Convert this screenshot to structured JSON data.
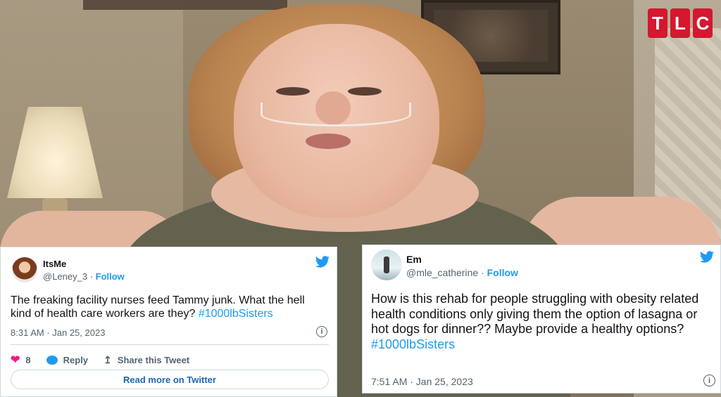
{
  "brand": {
    "logo_letters": [
      "T",
      "L",
      "C"
    ],
    "color": "#d3182f"
  },
  "tweet1": {
    "name": "ItsMe",
    "handle": "@Leney_3",
    "separator": " · ",
    "follow_label": "Follow",
    "text": "The freaking facility nurses feed Tammy junk. What the hell kind of health care workers are they? ",
    "hashtag": "#1000lbSisters",
    "timestamp": "8:31 AM · Jan 25, 2023",
    "likes": "8",
    "reply_label": "Reply",
    "share_label": "Share this Tweet",
    "read_more_label": "Read more on Twitter",
    "info_icon": "i"
  },
  "tweet2": {
    "name": "Em",
    "handle": "@mle_catherine",
    "separator": " · ",
    "follow_label": "Follow",
    "text": "How is this rehab for people struggling with obesity related health conditions only giving them the option of lasagna or hot dogs for dinner?? Maybe provide a healthy options?",
    "hashtag": "#1000lbSisters",
    "timestamp": "7:51 AM · Jan 25, 2023",
    "info_icon": "i"
  },
  "colors": {
    "twitter_blue": "#1d9bf0",
    "like_pink": "#f91880",
    "muted_text": "#536471"
  }
}
